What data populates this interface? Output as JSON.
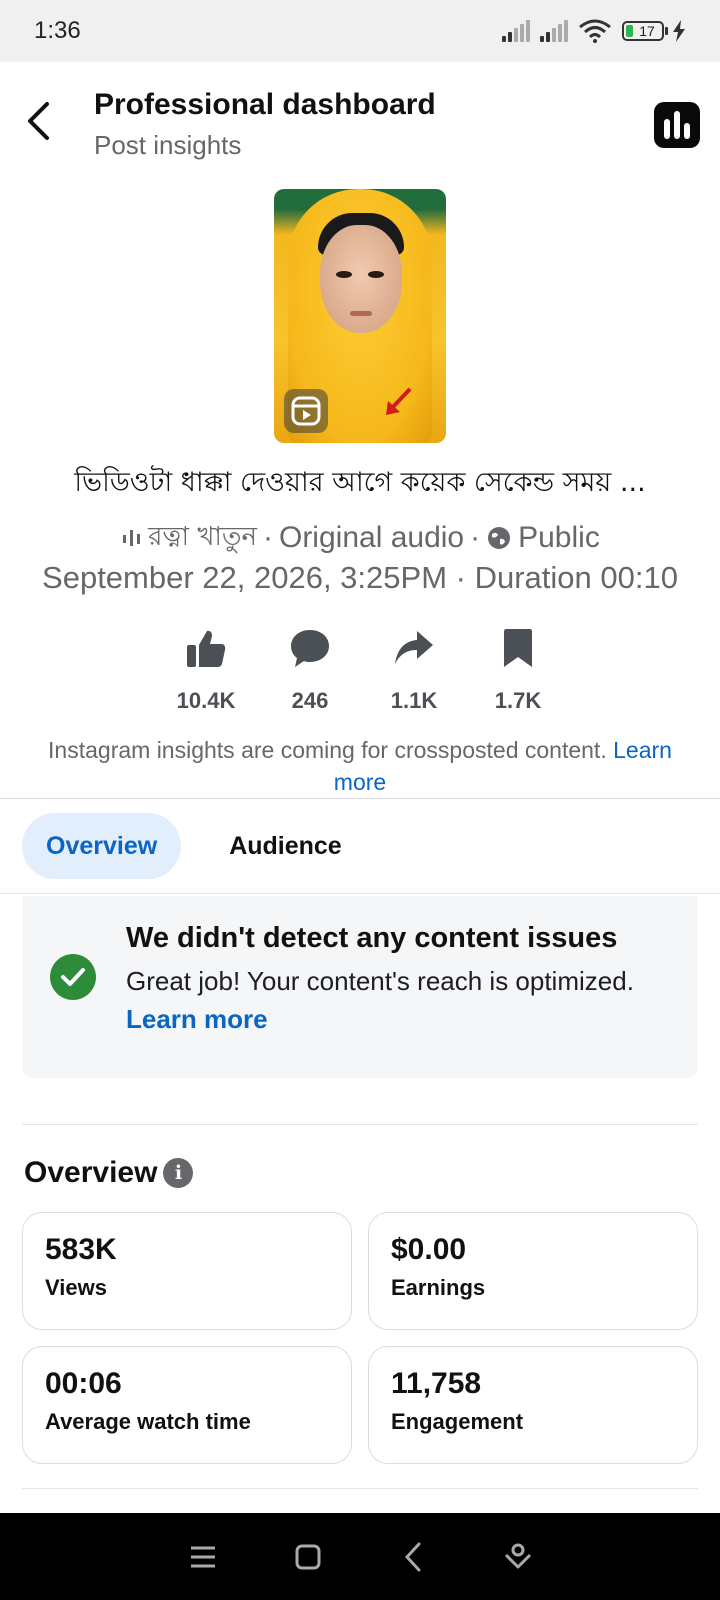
{
  "status_bar": {
    "time": "1:36",
    "battery": "17"
  },
  "header": {
    "title": "Professional dashboard",
    "subtitle": "Post insights",
    "back_icon": "chevron-left-icon",
    "insights_icon": "bar-chart-icon"
  },
  "post": {
    "caption": "ভিডিওটা ধাক্কা দেওয়ার আগে কয়েক সেকেন্ড সময় ...",
    "audio_author": "রত্না খাতুন",
    "audio_label": "Original audio",
    "visibility": "Public",
    "date": "September 22, 2026, 3:25PM",
    "duration_label": "Duration 00:10"
  },
  "stats": [
    {
      "icon": "thumbs-up-icon",
      "value": "10.4K"
    },
    {
      "icon": "comment-icon",
      "value": "246"
    },
    {
      "icon": "share-icon",
      "value": "1.1K"
    },
    {
      "icon": "bookmark-icon",
      "value": "1.7K"
    }
  ],
  "notice": {
    "text": "Instagram insights are coming for crossposted content.",
    "link": "Learn more"
  },
  "tabs": [
    {
      "label": "Overview",
      "active": true
    },
    {
      "label": "Audience",
      "active": false
    }
  ],
  "issues": {
    "title": "We didn't detect any content issues",
    "body": "Great job! Your content's reach is optimized.",
    "link": "Learn more"
  },
  "overview": {
    "heading": "Overview",
    "metrics": [
      {
        "value": "583K",
        "label": "Views"
      },
      {
        "value": "$0.00",
        "label": "Earnings"
      },
      {
        "value": "00:06",
        "label": "Average watch time"
      },
      {
        "value": "11,758",
        "label": "Engagement"
      }
    ]
  },
  "colors": {
    "accent": "#0a66c2",
    "success": "#2e8b3a",
    "muted": "#65676b"
  }
}
